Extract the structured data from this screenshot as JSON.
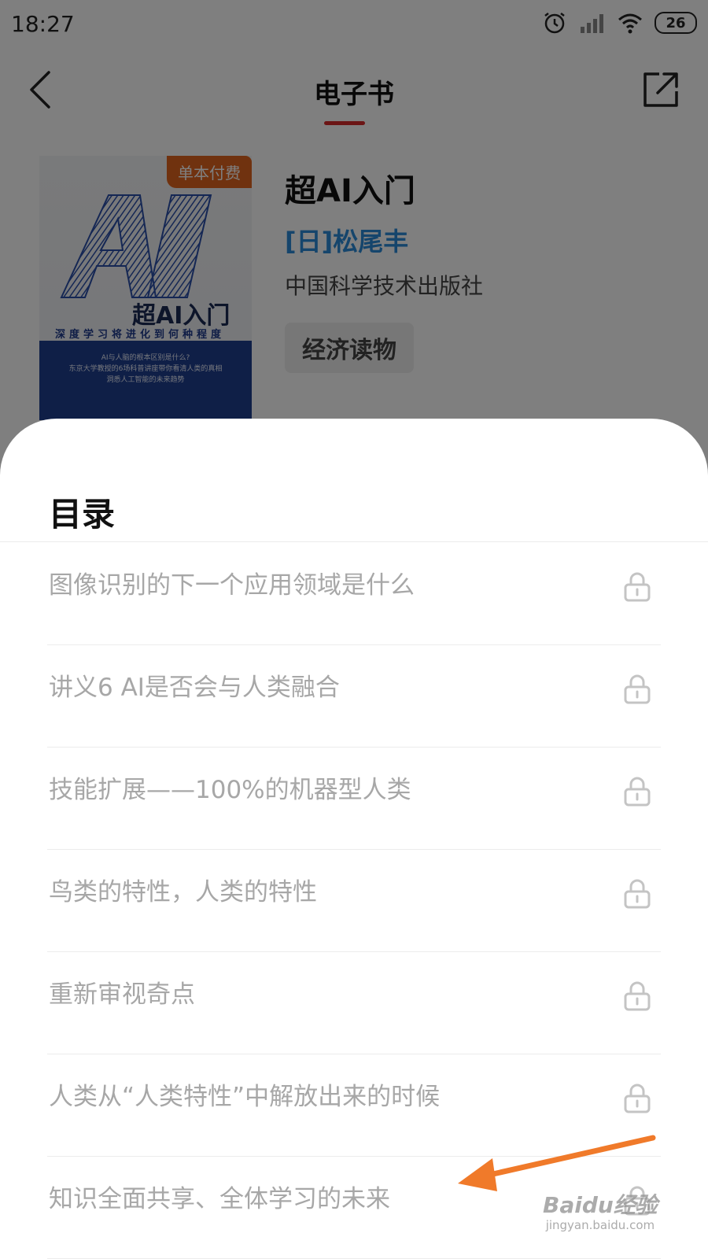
{
  "status_bar": {
    "time": "18:27",
    "battery": "26"
  },
  "nav": {
    "title": "电子书"
  },
  "book": {
    "badge": "单本付费",
    "title": "超AI入门",
    "author": "[日]松尾丰",
    "publisher": "中国科学技术出版社",
    "tag": "经济读物",
    "cover": {
      "big_text": "AI",
      "title": "超AI入门",
      "subtitle": "深度学习将进化到何种程度",
      "blurb_line1": "AI与人脑的根本区别是什么?",
      "blurb_line2": "东京大学教授的6场科普讲座带你看清人类的真相",
      "blurb_line3": "洞悉人工智能的未来趋势"
    }
  },
  "sheet": {
    "title": "目录",
    "items": [
      {
        "label": "图像识别的下一个应用领域是什么",
        "locked": true
      },
      {
        "label": "讲义6 AI是否会与人类融合",
        "locked": true
      },
      {
        "label": "技能扩展——100%的机器型人类",
        "locked": true
      },
      {
        "label": "鸟类的特性，人类的特性",
        "locked": true
      },
      {
        "label": "重新审视奇点",
        "locked": true
      },
      {
        "label": "人类从“人类特性”中解放出来的时候",
        "locked": true
      },
      {
        "label": "知识全面共享、全体学习的未来",
        "locked": true
      }
    ]
  },
  "overlay": {
    "watermark_main": "Baidu经验",
    "watermark_sub": "jingyan.baidu.com",
    "arrow_color": "#f07a2a"
  },
  "colors": {
    "accent": "#d72a2a",
    "author": "#2b8ad8",
    "badge": "#e0651f"
  }
}
